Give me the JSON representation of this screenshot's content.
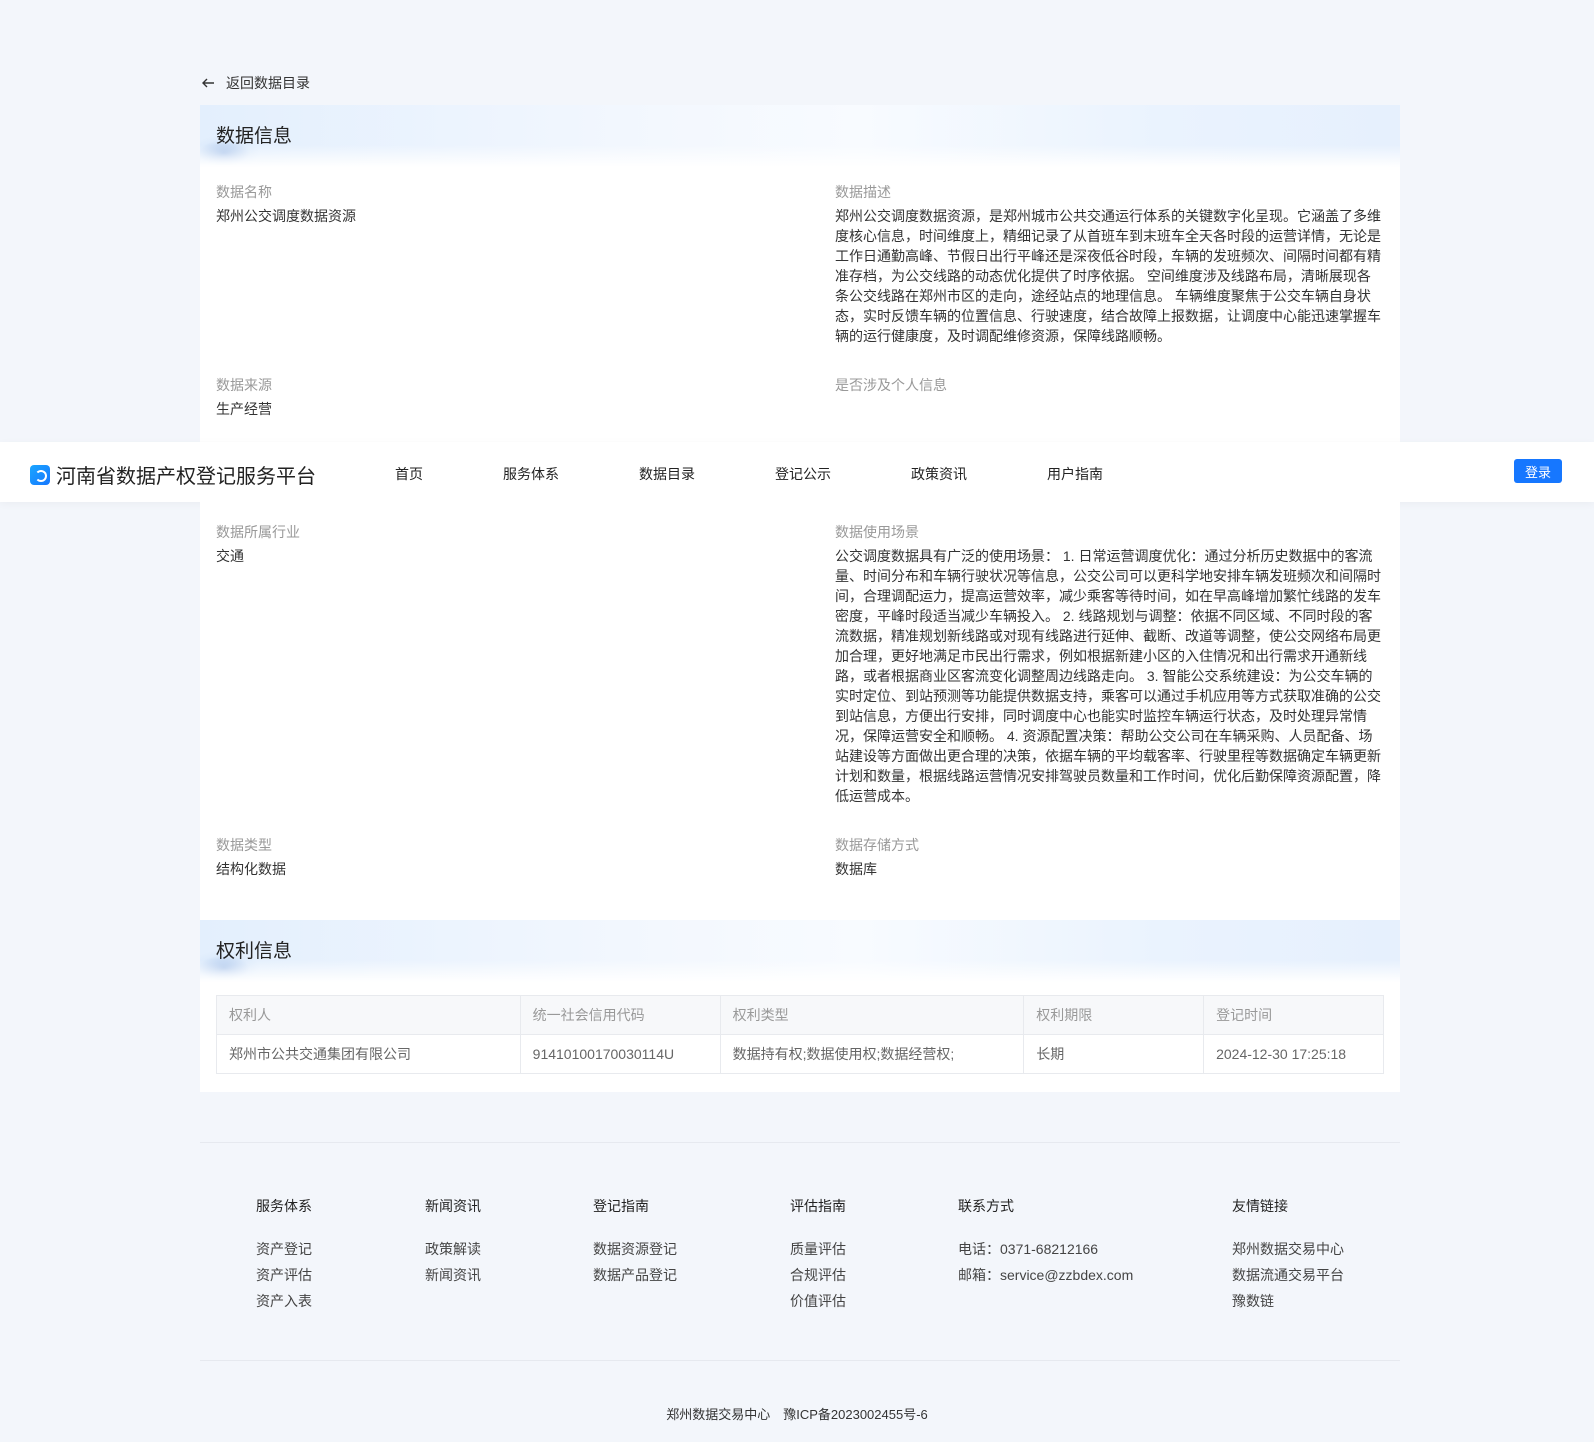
{
  "back_link": "返回数据目录",
  "data_info": {
    "title": "数据信息",
    "name_label": "数据名称",
    "name_value": "郑州公交调度数据资源",
    "desc_label": "数据描述",
    "desc_value": "郑州公交调度数据资源，是郑州城市公共交通运行体系的关键数字化呈现。它涵盖了多维度核心信息，时间维度上，精细记录了从首班车到末班车全天各时段的运营详情，无论是工作日通勤高峰、节假日出行平峰还是深夜低谷时段，车辆的发班频次、间隔时间都有精准存档，为公交线路的动态优化提供了时序依据。 空间维度涉及线路布局，清晰展现各条公交线路在郑州市区的走向，途经站点的地理信息。 车辆维度聚焦于公交车辆自身状态，实时反馈车辆的位置信息、行驶速度，结合故障上报数据，让调度中心能迅速掌握车辆的运行健康度，及时调配维修资源，保障线路顺畅。",
    "source_label": "数据来源",
    "source_value": "生产经营",
    "personal_label": "是否涉及个人信息",
    "personal_value": "",
    "industry_label": "数据所属行业",
    "industry_value": "交通",
    "scene_label": "数据使用场景",
    "scene_value": "公交调度数据具有广泛的使用场景： 1. 日常运营调度优化：通过分析历史数据中的客流量、时间分布和车辆行驶状况等信息，公交公司可以更科学地安排车辆发班频次和间隔时间，合理调配运力，提高运营效率，减少乘客等待时间，如在早高峰增加繁忙线路的发车密度，平峰时段适当减少车辆投入。 2. 线路规划与调整：依据不同区域、不同时段的客流数据，精准规划新线路或对现有线路进行延伸、截断、改道等调整，使公交网络布局更加合理，更好地满足市民出行需求，例如根据新建小区的入住情况和出行需求开通新线路，或者根据商业区客流变化调整周边线路走向。 3. 智能公交系统建设：为公交车辆的实时定位、到站预测等功能提供数据支持，乘客可以通过手机应用等方式获取准确的公交到站信息，方便出行安排，同时调度中心也能实时监控车辆运行状态，及时处理异常情况，保障运营安全和顺畅。 4. 资源配置决策：帮助公交公司在车辆采购、人员配备、场站建设等方面做出更合理的决策，依据车辆的平均载客率、行驶里程等数据确定车辆更新计划和数量，根据线路运营情况安排驾驶员数量和工作时间，优化后勤保障资源配置，降低运营成本。",
    "type_label": "数据类型",
    "type_value": "结构化数据",
    "storage_label": "数据存储方式",
    "storage_value": "数据库"
  },
  "nav": {
    "brand": "河南省数据产权登记服务平台",
    "items": [
      "首页",
      "服务体系",
      "数据目录",
      "登记公示",
      "政策资讯",
      "用户指南"
    ],
    "login": "登录"
  },
  "rights": {
    "title": "权利信息",
    "headers": [
      "权利人",
      "统一社会信用代码",
      "权利类型",
      "权利期限",
      "登记时间"
    ],
    "row": [
      "郑州市公共交通集团有限公司",
      "91410100170030114U",
      "数据持有权;数据使用权;数据经营权;",
      "长期",
      "2024-12-30 17:25:18"
    ]
  },
  "footer": {
    "cols": [
      {
        "head": "服务体系",
        "items": [
          "资产登记",
          "资产评估",
          "资产入表"
        ]
      },
      {
        "head": "新闻资讯",
        "items": [
          "政策解读",
          "新闻资讯"
        ]
      },
      {
        "head": "登记指南",
        "items": [
          "数据资源登记",
          "数据产品登记"
        ]
      },
      {
        "head": "评估指南",
        "items": [
          "质量评估",
          "合规评估",
          "价值评估"
        ]
      },
      {
        "head": "联系方式",
        "items": [
          "电话：0371-68212166",
          "邮箱：service@zzbdex.com"
        ]
      },
      {
        "head": "友情链接",
        "items": [
          "郑州数据交易中心",
          "数据流通交易平台",
          "豫数链"
        ]
      }
    ],
    "copyright": "郑州数据交易中心　豫ICP备2023002455号-6"
  }
}
